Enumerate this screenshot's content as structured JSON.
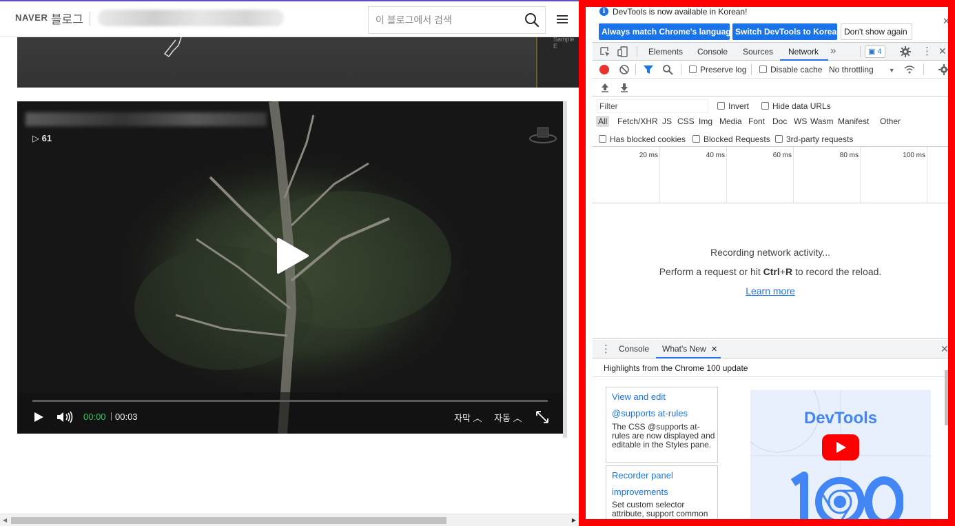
{
  "blog": {
    "brand_naver": "NAVER",
    "brand_blog": "블로그",
    "search_placeholder": "이 블로그에서 검색",
    "video": {
      "view_count": "▷ 61",
      "time_current": "00:00",
      "time_total": "00:03",
      "subtitle_label": "자막 ︿",
      "auto_label": "자동 ︿"
    },
    "top_video_label": "Sample E"
  },
  "devtools": {
    "infobar": {
      "message": "DevTools is now available in Korean!",
      "btn_match": "Always match Chrome's language",
      "btn_switch": "Switch DevTools to Korean",
      "btn_dont_show": "Don't show again"
    },
    "tabs": [
      "Elements",
      "Console",
      "Sources",
      "Network"
    ],
    "active_tab": "Network",
    "more_tabs": "»",
    "issues_count": "4",
    "toolbar": {
      "preserve_log": "Preserve log",
      "disable_cache": "Disable cache",
      "throttling": "No throttling"
    },
    "filter": {
      "placeholder": "Filter",
      "invert": "Invert",
      "hide_data_urls": "Hide data URLs",
      "types": [
        "All",
        "Fetch/XHR",
        "JS",
        "CSS",
        "Img",
        "Media",
        "Font",
        "Doc",
        "WS",
        "Wasm",
        "Manifest",
        "Other"
      ],
      "has_blocked_cookies": "Has blocked cookies",
      "blocked_requests": "Blocked Requests",
      "third_party": "3rd-party requests"
    },
    "timeline_labels": [
      "20 ms",
      "40 ms",
      "60 ms",
      "80 ms",
      "100 ms"
    ],
    "empty": {
      "line1": "Recording network activity...",
      "line2_pre": "Perform a request or hit",
      "line2_key1": "Ctrl",
      "line2_plus": "+",
      "line2_key2": "R",
      "line2_post": "to record the reload.",
      "learn_more": "Learn more"
    },
    "drawer": {
      "tab_console": "Console",
      "tab_whats_new": "What's New",
      "highlights": "Highlights from the Chrome 100 update",
      "cards": [
        {
          "title1": "View and edit",
          "title2": "@supports at-rules",
          "desc": "The CSS @supports at-rules are now displayed and editable in the Styles pane."
        },
        {
          "title1": "Recorder panel",
          "title2": "improvements",
          "desc": "Set custom selector attribute, support common selector"
        }
      ],
      "banner_title": "DevTools"
    }
  },
  "colors": {
    "devtools_accent": "#1a73e8",
    "highlight_frame": "#ff0000",
    "video_time_current": "#2ecc5b"
  }
}
